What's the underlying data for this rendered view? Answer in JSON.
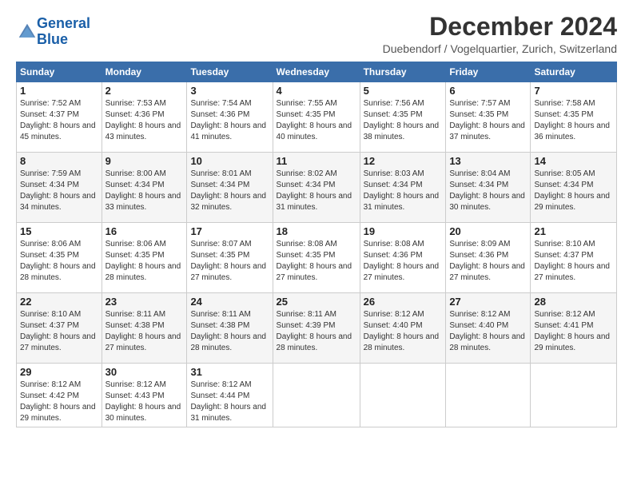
{
  "header": {
    "logo_line1": "General",
    "logo_line2": "Blue",
    "title": "December 2024",
    "subtitle": "Duebendorf / Vogelquartier, Zurich, Switzerland"
  },
  "days_of_week": [
    "Sunday",
    "Monday",
    "Tuesday",
    "Wednesday",
    "Thursday",
    "Friday",
    "Saturday"
  ],
  "weeks": [
    [
      {
        "day": "1",
        "sunrise": "7:52 AM",
        "sunset": "4:37 PM",
        "daylight": "8 hours and 45 minutes."
      },
      {
        "day": "2",
        "sunrise": "7:53 AM",
        "sunset": "4:36 PM",
        "daylight": "8 hours and 43 minutes."
      },
      {
        "day": "3",
        "sunrise": "7:54 AM",
        "sunset": "4:36 PM",
        "daylight": "8 hours and 41 minutes."
      },
      {
        "day": "4",
        "sunrise": "7:55 AM",
        "sunset": "4:35 PM",
        "daylight": "8 hours and 40 minutes."
      },
      {
        "day": "5",
        "sunrise": "7:56 AM",
        "sunset": "4:35 PM",
        "daylight": "8 hours and 38 minutes."
      },
      {
        "day": "6",
        "sunrise": "7:57 AM",
        "sunset": "4:35 PM",
        "daylight": "8 hours and 37 minutes."
      },
      {
        "day": "7",
        "sunrise": "7:58 AM",
        "sunset": "4:35 PM",
        "daylight": "8 hours and 36 minutes."
      }
    ],
    [
      {
        "day": "8",
        "sunrise": "7:59 AM",
        "sunset": "4:34 PM",
        "daylight": "8 hours and 34 minutes."
      },
      {
        "day": "9",
        "sunrise": "8:00 AM",
        "sunset": "4:34 PM",
        "daylight": "8 hours and 33 minutes."
      },
      {
        "day": "10",
        "sunrise": "8:01 AM",
        "sunset": "4:34 PM",
        "daylight": "8 hours and 32 minutes."
      },
      {
        "day": "11",
        "sunrise": "8:02 AM",
        "sunset": "4:34 PM",
        "daylight": "8 hours and 31 minutes."
      },
      {
        "day": "12",
        "sunrise": "8:03 AM",
        "sunset": "4:34 PM",
        "daylight": "8 hours and 31 minutes."
      },
      {
        "day": "13",
        "sunrise": "8:04 AM",
        "sunset": "4:34 PM",
        "daylight": "8 hours and 30 minutes."
      },
      {
        "day": "14",
        "sunrise": "8:05 AM",
        "sunset": "4:34 PM",
        "daylight": "8 hours and 29 minutes."
      }
    ],
    [
      {
        "day": "15",
        "sunrise": "8:06 AM",
        "sunset": "4:35 PM",
        "daylight": "8 hours and 28 minutes."
      },
      {
        "day": "16",
        "sunrise": "8:06 AM",
        "sunset": "4:35 PM",
        "daylight": "8 hours and 28 minutes."
      },
      {
        "day": "17",
        "sunrise": "8:07 AM",
        "sunset": "4:35 PM",
        "daylight": "8 hours and 27 minutes."
      },
      {
        "day": "18",
        "sunrise": "8:08 AM",
        "sunset": "4:35 PM",
        "daylight": "8 hours and 27 minutes."
      },
      {
        "day": "19",
        "sunrise": "8:08 AM",
        "sunset": "4:36 PM",
        "daylight": "8 hours and 27 minutes."
      },
      {
        "day": "20",
        "sunrise": "8:09 AM",
        "sunset": "4:36 PM",
        "daylight": "8 hours and 27 minutes."
      },
      {
        "day": "21",
        "sunrise": "8:10 AM",
        "sunset": "4:37 PM",
        "daylight": "8 hours and 27 minutes."
      }
    ],
    [
      {
        "day": "22",
        "sunrise": "8:10 AM",
        "sunset": "4:37 PM",
        "daylight": "8 hours and 27 minutes."
      },
      {
        "day": "23",
        "sunrise": "8:11 AM",
        "sunset": "4:38 PM",
        "daylight": "8 hours and 27 minutes."
      },
      {
        "day": "24",
        "sunrise": "8:11 AM",
        "sunset": "4:38 PM",
        "daylight": "8 hours and 28 minutes."
      },
      {
        "day": "25",
        "sunrise": "8:11 AM",
        "sunset": "4:39 PM",
        "daylight": "8 hours and 28 minutes."
      },
      {
        "day": "26",
        "sunrise": "8:12 AM",
        "sunset": "4:40 PM",
        "daylight": "8 hours and 28 minutes."
      },
      {
        "day": "27",
        "sunrise": "8:12 AM",
        "sunset": "4:40 PM",
        "daylight": "8 hours and 28 minutes."
      },
      {
        "day": "28",
        "sunrise": "8:12 AM",
        "sunset": "4:41 PM",
        "daylight": "8 hours and 29 minutes."
      }
    ],
    [
      {
        "day": "29",
        "sunrise": "8:12 AM",
        "sunset": "4:42 PM",
        "daylight": "8 hours and 29 minutes."
      },
      {
        "day": "30",
        "sunrise": "8:12 AM",
        "sunset": "4:43 PM",
        "daylight": "8 hours and 30 minutes."
      },
      {
        "day": "31",
        "sunrise": "8:12 AM",
        "sunset": "4:44 PM",
        "daylight": "8 hours and 31 minutes."
      },
      null,
      null,
      null,
      null
    ]
  ]
}
